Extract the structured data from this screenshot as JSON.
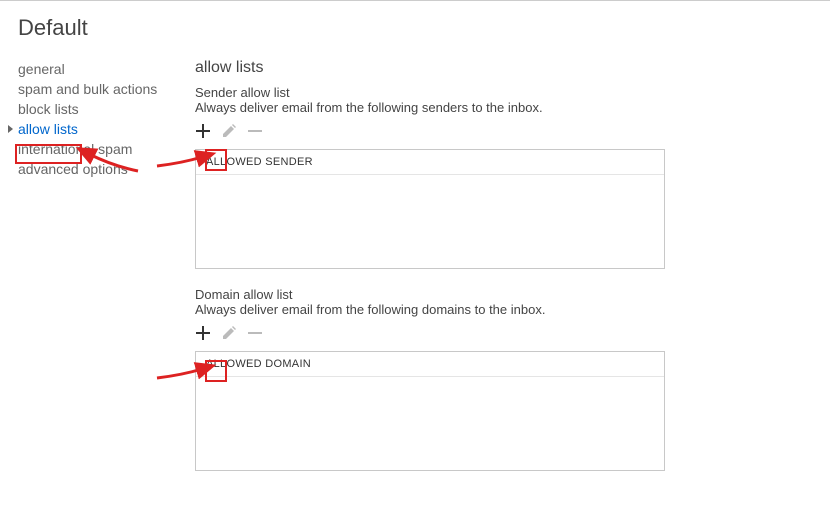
{
  "title": "Default",
  "sidebar": {
    "items": [
      {
        "label": "general"
      },
      {
        "label": "spam and bulk actions"
      },
      {
        "label": "block lists"
      },
      {
        "label": "allow lists"
      },
      {
        "label": "international spam"
      },
      {
        "label": "advanced options"
      }
    ],
    "active_index": 3
  },
  "main": {
    "heading": "allow lists",
    "sender": {
      "subheading": "Sender allow list",
      "description": "Always deliver email from the following senders to the inbox.",
      "column_header": "ALLOWED SENDER"
    },
    "domain": {
      "subheading": "Domain allow list",
      "description": "Always deliver email from the following domains to the inbox.",
      "column_header": "ALLOWED DOMAIN"
    }
  }
}
